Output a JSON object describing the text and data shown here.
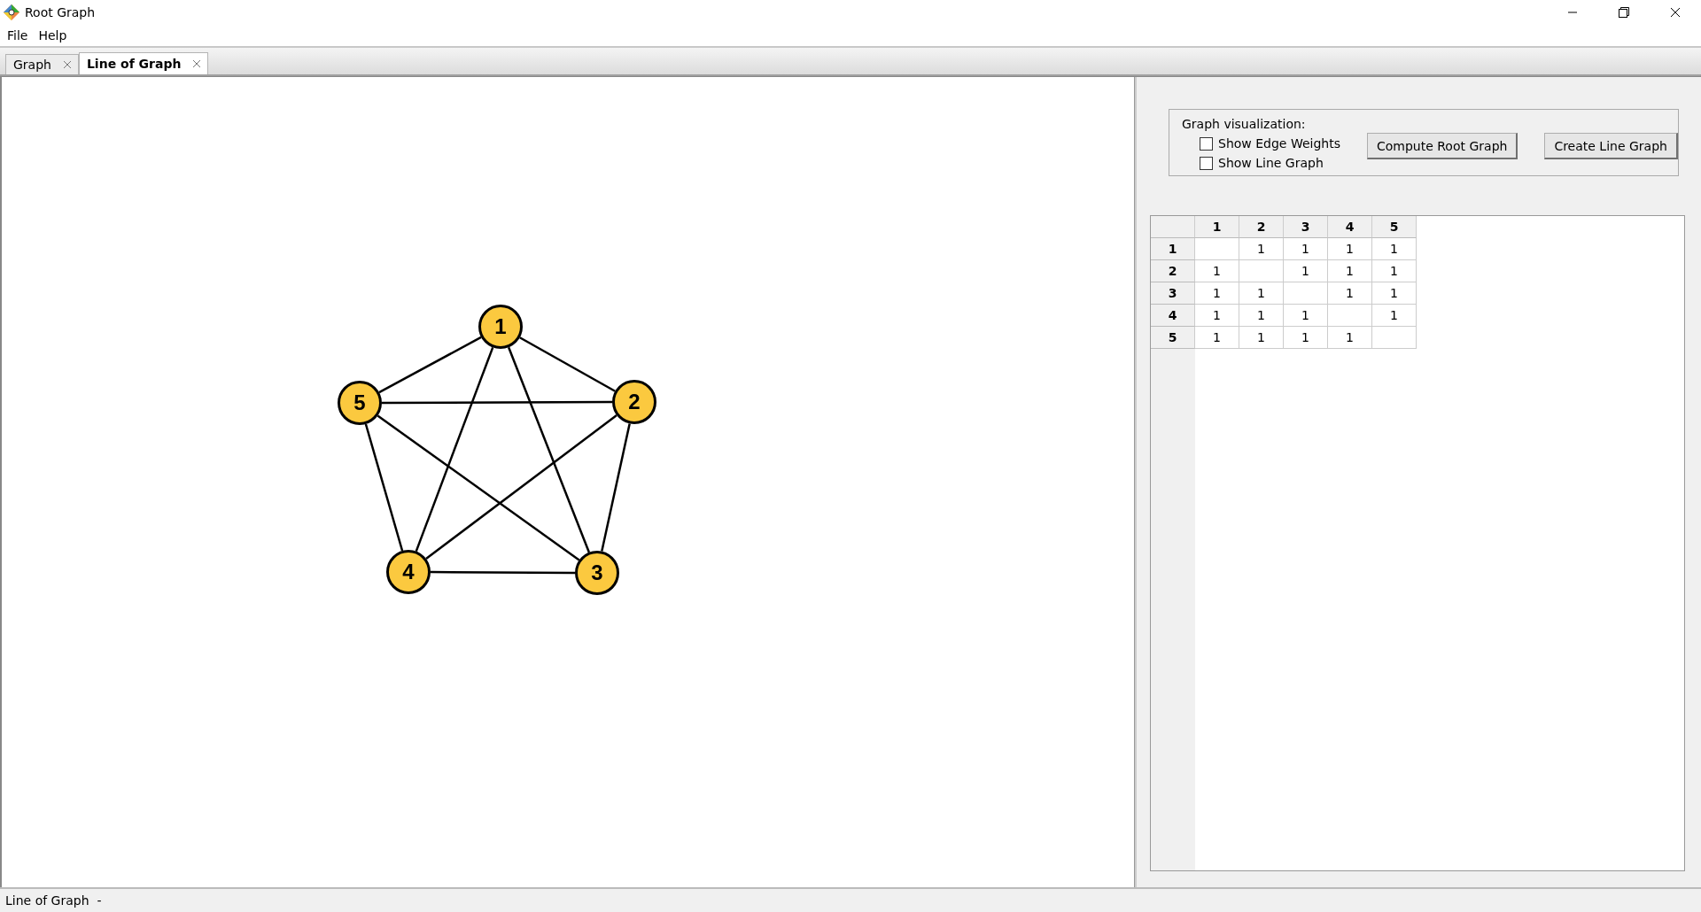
{
  "window": {
    "title": "Root Graph"
  },
  "menu": [
    "File",
    "Help"
  ],
  "tabs": [
    {
      "label": "Graph",
      "selected": false
    },
    {
      "label": "Line of Graph",
      "selected": true
    }
  ],
  "graph": {
    "nodes": [
      "1",
      "2",
      "3",
      "4",
      "5"
    ]
  },
  "controls": {
    "group_title": "Graph visualization:",
    "checkboxes": [
      {
        "label": "Show Edge Weights",
        "checked": false
      },
      {
        "label": "Show Line Graph",
        "checked": false
      }
    ],
    "buttons": [
      "Compute Root Graph",
      "Create Line Graph"
    ]
  },
  "matrix": {
    "columns": [
      "1",
      "2",
      "3",
      "4",
      "5"
    ],
    "rows": [
      {
        "header": "1",
        "cells": [
          null,
          "1",
          "1",
          "1",
          "1"
        ]
      },
      {
        "header": "2",
        "cells": [
          "1",
          null,
          "1",
          "1",
          "1"
        ]
      },
      {
        "header": "3",
        "cells": [
          "1",
          "1",
          null,
          "1",
          "1"
        ]
      },
      {
        "header": "4",
        "cells": [
          "1",
          "1",
          "1",
          null,
          "1"
        ]
      },
      {
        "header": "5",
        "cells": [
          "1",
          "1",
          "1",
          "1",
          null
        ]
      }
    ]
  },
  "status_bar": {
    "text": "Line of Graph  -"
  }
}
